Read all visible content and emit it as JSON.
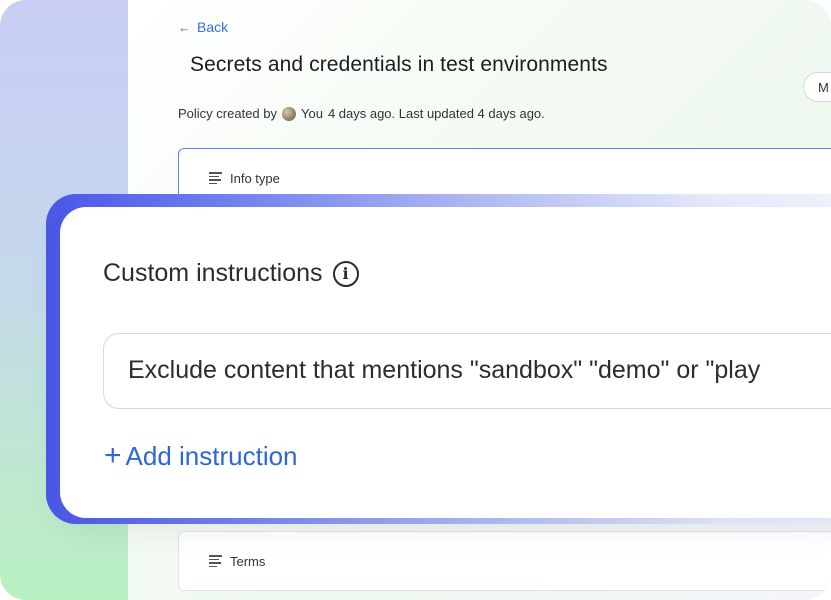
{
  "header": {
    "back_label": "Back",
    "title": "Secrets and credentials in test environments",
    "more_button_label": "M"
  },
  "meta": {
    "prefix": "Policy created by",
    "author": "You",
    "suffix": "4 days ago. Last updated 4 days ago."
  },
  "sections": {
    "info_type_label": "Info type",
    "terms_label": "Terms"
  },
  "custom_instructions": {
    "heading": "Custom instructions",
    "instruction_value": "Exclude content that mentions \"sandbox\" \"demo\" or \"play",
    "add_label": "Add instruction"
  },
  "icons": {
    "back": "arrow-left-icon",
    "info": "info-circle-icon",
    "lines": "text-lines-icon",
    "plus": "plus-icon"
  },
  "colors": {
    "accent": "#2f66d6",
    "card_border_active": "#5b86e5"
  }
}
